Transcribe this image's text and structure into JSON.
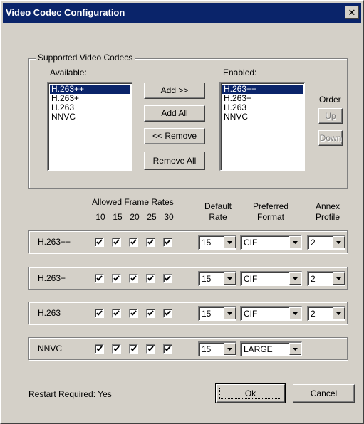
{
  "window": {
    "title": "Video Codec Configuration",
    "close_glyph": "✕"
  },
  "supported": {
    "group_label": "Supported Video Codecs",
    "available_label": "Available:",
    "enabled_label": "Enabled:",
    "available": [
      "H.263++",
      "H.263+",
      "H.263",
      "NNVC"
    ],
    "available_selected": 0,
    "enabled": [
      "H.263++",
      "H.263+",
      "H.263",
      "NNVC"
    ],
    "enabled_selected": 0,
    "buttons": {
      "add": "Add >>",
      "add_all": "Add All",
      "remove": "<< Remove",
      "remove_all": "Remove All"
    },
    "order": {
      "label": "Order",
      "up": "Up",
      "down": "Down"
    }
  },
  "headers": {
    "allowed_frame_rates": "Allowed Frame Rates",
    "rates": [
      "10",
      "15",
      "20",
      "25",
      "30"
    ],
    "default_rate": [
      "Default",
      "Rate"
    ],
    "preferred_format": [
      "Preferred",
      "Format"
    ],
    "annex_profile": [
      "Annex",
      "Profile"
    ]
  },
  "codecs": [
    {
      "name": "H.263++",
      "frames": [
        true,
        true,
        true,
        true,
        true
      ],
      "default_rate": "15",
      "format": "CIF",
      "annex": "2"
    },
    {
      "name": "H.263+",
      "frames": [
        true,
        true,
        true,
        true,
        true
      ],
      "default_rate": "15",
      "format": "CIF",
      "annex": "2"
    },
    {
      "name": "H.263",
      "frames": [
        true,
        true,
        true,
        true,
        true
      ],
      "default_rate": "15",
      "format": "CIF",
      "annex": "2"
    },
    {
      "name": "NNVC",
      "frames": [
        true,
        true,
        true,
        true,
        true
      ],
      "default_rate": "15",
      "format": "LARGE",
      "annex": null
    }
  ],
  "footer": {
    "restart_label": "Restart Required:",
    "restart_value": "Yes",
    "ok": "Ok",
    "cancel": "Cancel"
  },
  "colors": {
    "title_bar": "#0a246a",
    "face": "#d4d0c8",
    "selection": "#0a246a"
  },
  "icons": {
    "close": "close-icon",
    "dropdown": "chevron-down-icon",
    "check": "checkmark-icon"
  }
}
